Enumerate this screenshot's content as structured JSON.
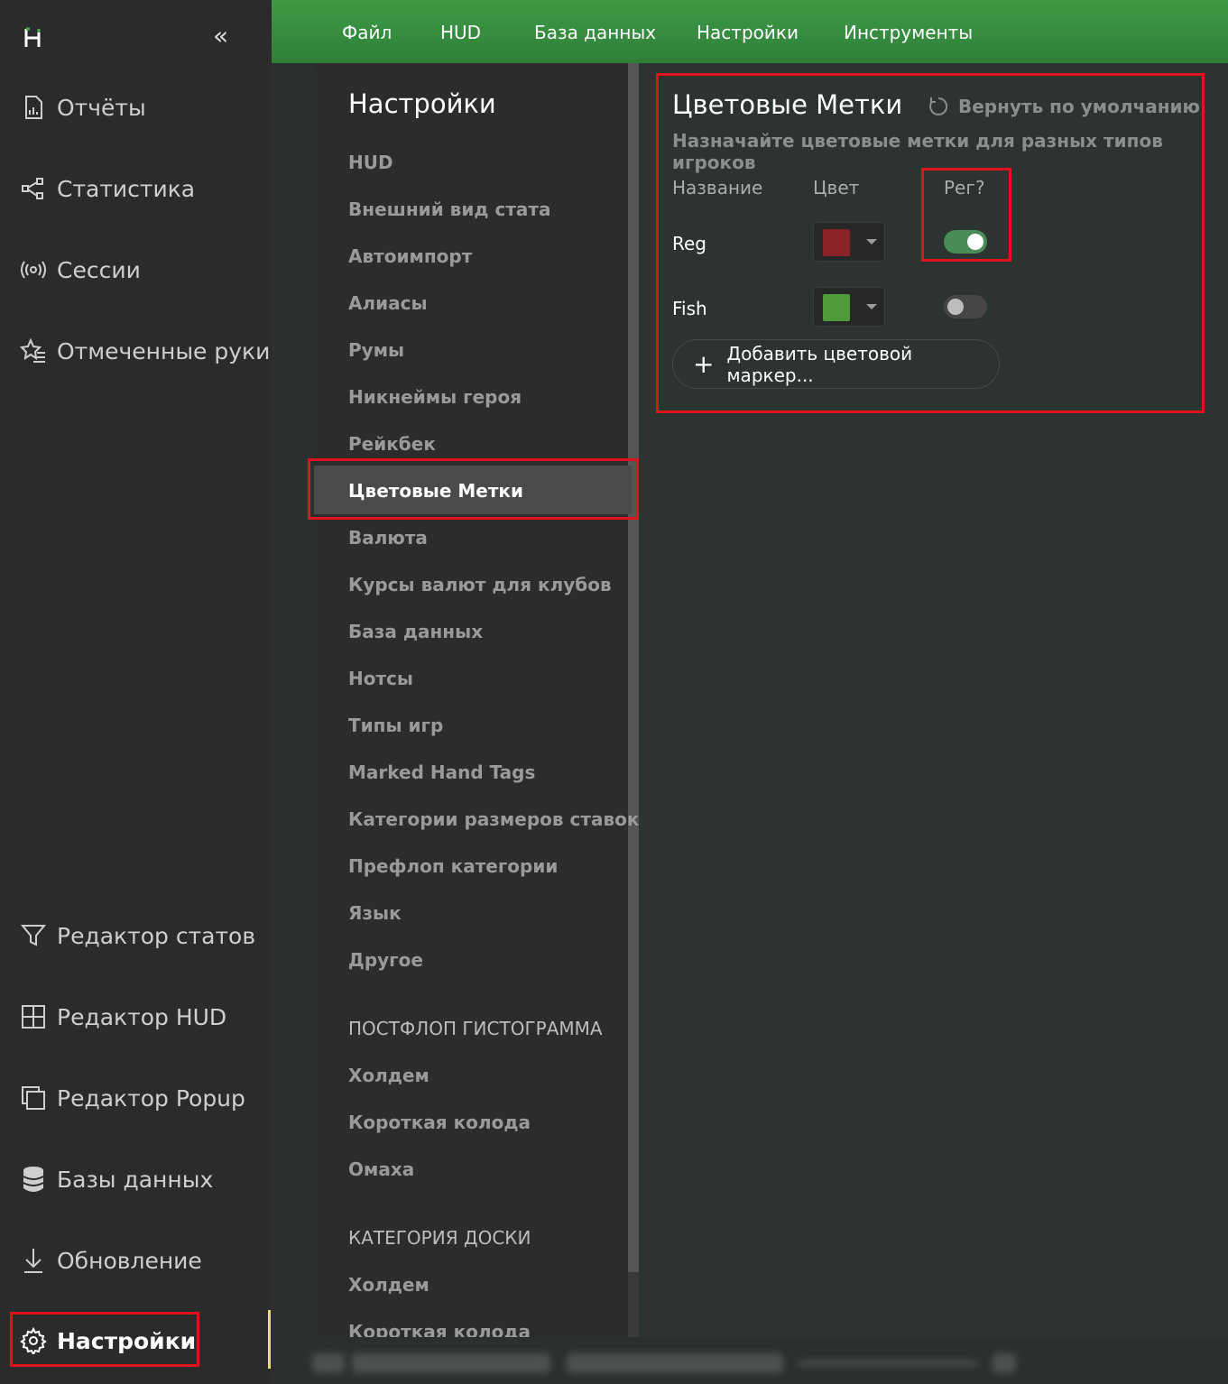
{
  "sidebar": {
    "collapse_icon": "chevrons-left-icon",
    "items_top": [
      {
        "label": "Отчёты",
        "icon": "report-icon"
      },
      {
        "label": "Статистика",
        "icon": "share-nodes-icon"
      },
      {
        "label": "Сессии",
        "icon": "broadcast-icon"
      },
      {
        "label": "Отмеченные руки",
        "icon": "star-list-icon"
      }
    ],
    "items_bottom": [
      {
        "label": "Редактор статов",
        "icon": "filter-icon"
      },
      {
        "label": "Редактор HUD",
        "icon": "layout-icon"
      },
      {
        "label": "Редактор Popup",
        "icon": "windows-icon"
      },
      {
        "label": "Базы данных",
        "icon": "database-icon"
      },
      {
        "label": "Обновление",
        "icon": "download-icon"
      },
      {
        "label": "Настройки",
        "icon": "gear-icon",
        "active": true
      }
    ]
  },
  "menu": {
    "items": [
      "Файл",
      "HUD",
      "База данных",
      "Настройки",
      "Инструменты"
    ]
  },
  "settings": {
    "title": "Настройки",
    "items": [
      "HUD",
      "Внешний вид стата",
      "Автоимпорт",
      "Алиасы",
      "Румы",
      "Никнеймы героя",
      "Рейкбек",
      "Цветовые Метки",
      "Валюта",
      "Курсы валют для клубов",
      "База данных",
      "Нотсы",
      "Типы игр",
      "Marked Hand Tags",
      "Категории размеров ставок",
      "Префлоп категории",
      "Язык",
      "Другое"
    ],
    "active_item": "Цветовые Метки",
    "section_postflop": "ПОСТФЛОП ГИСТОГРАММА",
    "postflop_items": [
      "Холдем",
      "Короткая колода",
      "Омаха"
    ],
    "section_board": "КАТЕГОРИЯ ДОСКИ",
    "board_items": [
      "Холдем",
      "Короткая колода"
    ]
  },
  "content": {
    "title": "Цветовые Метки",
    "reset_label": "Вернуть по умолчанию",
    "subtitle": "Назначайте цветовые метки для разных типов игроков",
    "col_name": "Название",
    "col_color": "Цвет",
    "col_reg": "Рег?",
    "rows": [
      {
        "name": "Reg",
        "color": "#8b2227",
        "reg": true
      },
      {
        "name": "Fish",
        "color": "#4f9a3a",
        "reg": false
      }
    ],
    "add_label": "Добавить цветовой маркер..."
  },
  "colors": {
    "accent_green": "#3e9b47",
    "highlight_red": "#e0121b"
  }
}
